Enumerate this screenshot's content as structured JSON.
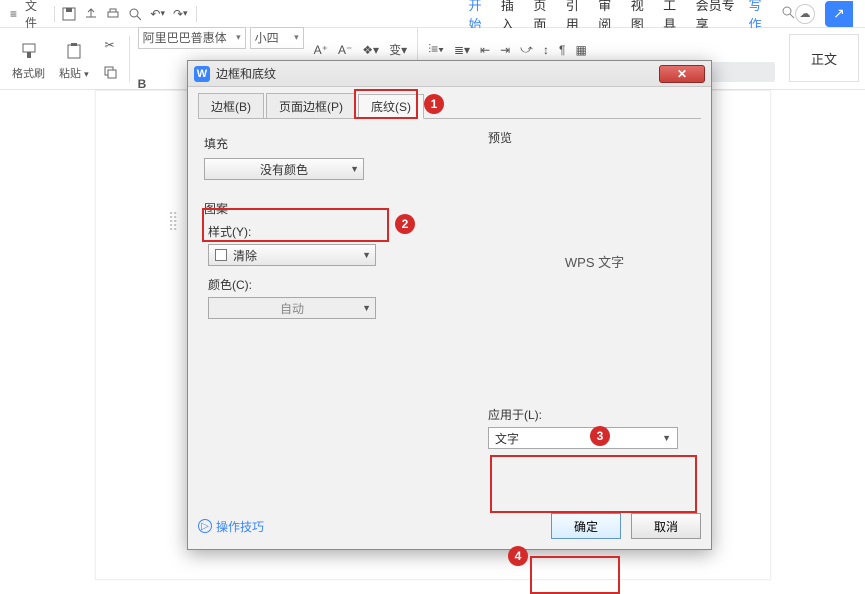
{
  "menubar": {
    "file": "文件",
    "tabs": {
      "start": "开始",
      "insert": "插入",
      "page": "页面",
      "reference": "引用",
      "review": "审阅",
      "view": "视图",
      "tools": "工具",
      "member": "会员专享",
      "write": "写作"
    }
  },
  "ribbon": {
    "format_painter": "格式刷",
    "paste": "粘贴",
    "font_name": "阿里巴巴普惠体",
    "font_size": "小四",
    "bold": "B",
    "body_style": "正文"
  },
  "dialog": {
    "title": "边框和底纹",
    "close_x": "✕",
    "tabs": {
      "border": "边框(B)",
      "page_border": "页面边框(P)",
      "shading": "底纹(S)"
    },
    "fill_label": "填充",
    "fill_value": "没有颜色",
    "pattern_label": "图案",
    "style_label": "样式(Y):",
    "style_value": "清除",
    "color_label": "颜色(C):",
    "color_value": "自动",
    "preview_label": "预览",
    "preview_text": "WPS 文字",
    "apply_label": "应用于(L):",
    "apply_value": "文字",
    "tips": "操作技巧",
    "ok": "确定",
    "cancel": "取消"
  },
  "callouts": {
    "1": "1",
    "2": "2",
    "3": "3",
    "4": "4"
  }
}
